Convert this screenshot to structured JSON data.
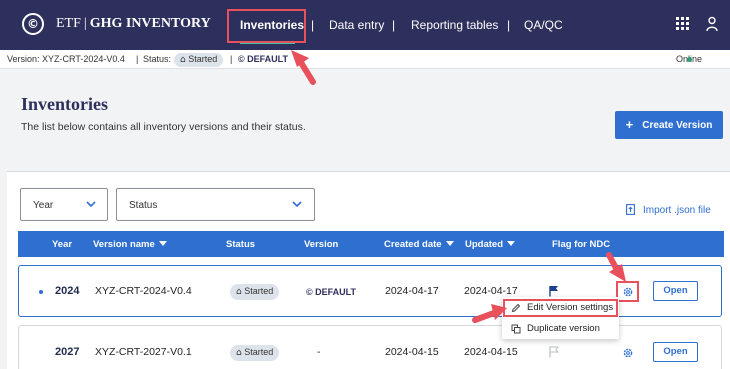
{
  "app": {
    "logo_glyph": "©",
    "brand_left": "ETF",
    "brand_sep": "|",
    "brand_right": "GHG INVENTORY"
  },
  "nav": {
    "items": [
      {
        "label": "Inventories",
        "active": true
      },
      {
        "label": "Data entry",
        "active": false
      },
      {
        "label": "Reporting tables",
        "active": false
      },
      {
        "label": "QA/QC",
        "active": false
      }
    ],
    "separator": "|"
  },
  "statusbar": {
    "version_text": "Version: XYZ-CRT-2024-V0.4",
    "sep": "|",
    "status_label": "Status:",
    "status_value": "Started",
    "default_badge": "© DEFAULT",
    "online": "Online"
  },
  "header": {
    "title": "Inventories",
    "subtitle": "The list below contains all inventory versions and their status.",
    "create_button": "Create Version",
    "create_plus": "+"
  },
  "filters": {
    "year_label": "Year",
    "status_label": "Status",
    "import_label": "Import .json file"
  },
  "table": {
    "columns": [
      "Year",
      "Version name",
      "Status",
      "Version",
      "Created date",
      "Updated",
      "Flag for NDC"
    ],
    "rows": [
      {
        "year": "2024",
        "version_name": "XYZ-CRT-2024-V0.4",
        "status": "Started",
        "version": "© DEFAULT",
        "created": "2024-04-17",
        "updated": "2024-04-17",
        "flag_ndc": true,
        "open": "Open"
      },
      {
        "year": "2027",
        "version_name": "XYZ-CRT-2027-V0.1",
        "status": "Started",
        "version": "-",
        "created": "2024-04-15",
        "updated": "2024-04-15",
        "flag_ndc": false,
        "open": "Open"
      }
    ]
  },
  "context_menu": {
    "items": [
      {
        "label": "Edit Version settings",
        "icon": "pencil-icon"
      },
      {
        "label": "Duplicate version",
        "icon": "copy-icon"
      }
    ]
  },
  "colors": {
    "navbar": "#2d2f5c",
    "accent": "#2f6fd0",
    "active_underline": "#3fc6a4",
    "highlight": "#e8505b",
    "online": "#2aa072"
  }
}
